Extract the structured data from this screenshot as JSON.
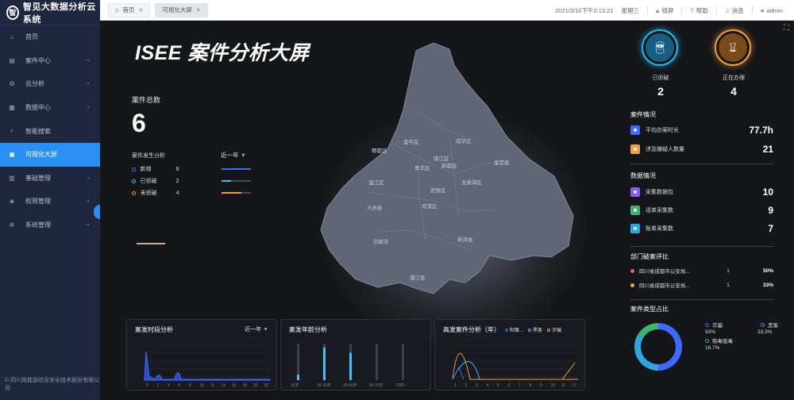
{
  "app": {
    "title": "智见大数据分析云系统",
    "logo_text": "智",
    "copyright": "© 四川效能源信息安全技术股份有限公司"
  },
  "sidebar": {
    "items": [
      {
        "label": "首页",
        "icon": "home-icon",
        "chevron": false
      },
      {
        "label": "案件中心",
        "icon": "case-icon",
        "chevron": true
      },
      {
        "label": "云分析",
        "icon": "analysis-icon",
        "chevron": true
      },
      {
        "label": "数据中心",
        "icon": "database-icon",
        "chevron": true
      },
      {
        "label": "智能搜索",
        "icon": "search-icon",
        "chevron": false
      },
      {
        "label": "可视化大屏",
        "icon": "dashboard-icon",
        "chevron": false,
        "active": true
      },
      {
        "label": "基础管理",
        "icon": "settings-icon",
        "chevron": true
      },
      {
        "label": "权限管理",
        "icon": "shield-icon",
        "chevron": true
      },
      {
        "label": "系统管理",
        "icon": "gear-icon",
        "chevron": true
      }
    ]
  },
  "tabs": [
    {
      "label": "首页"
    },
    {
      "label": "可视化大屏",
      "active": true
    }
  ],
  "header": {
    "datetime": "2021/3/10下午2:13:21",
    "weekday": "星期三",
    "lock": "锁屏",
    "help": "帮助",
    "messages": "消息",
    "user": "admin"
  },
  "dashboard": {
    "title": "ISEE 案件分析大屏",
    "total_label": "案件总数",
    "total_value": "6",
    "distribution_title": "案件发生分析",
    "range": "近一年",
    "distribution": [
      {
        "label": "新增",
        "count": "6",
        "ratio": 1.0,
        "color": "#3e6bff"
      },
      {
        "label": "已侦破",
        "count": "2",
        "ratio": 0.33,
        "color": "#3cc3ff"
      },
      {
        "label": "未侦破",
        "count": "4",
        "ratio": 0.67,
        "color": "#f0a040"
      }
    ],
    "map_labels": [
      {
        "text": "金牛区"
      },
      {
        "text": "成华区"
      },
      {
        "text": "郫都区"
      },
      {
        "text": "锦江区"
      },
      {
        "text": "新都区"
      },
      {
        "text": "青羊区"
      },
      {
        "text": "金堂县"
      },
      {
        "text": "温江区"
      },
      {
        "text": "武侯区"
      },
      {
        "text": "龙泉驿区"
      },
      {
        "text": "双流区"
      },
      {
        "text": "大邑县"
      },
      {
        "text": "邛崃市"
      },
      {
        "text": "新津县"
      },
      {
        "text": "蒲江县"
      }
    ],
    "solved": {
      "label": "已侦破",
      "value": "2"
    },
    "processing": {
      "label": "正在办理",
      "value": "4"
    },
    "case_info": {
      "title": "案件情况",
      "rows": [
        {
          "label": "平均办案时长",
          "value": "77.7h",
          "color": "#3e6bff"
        },
        {
          "label": "涉及嫌疑人数量",
          "value": "21",
          "color": "#f0a040"
        }
      ]
    },
    "data_info": {
      "title": "数据情况",
      "rows": [
        {
          "label": "采集数据包",
          "value": "10",
          "color": "#8a5cf6"
        },
        {
          "label": "话单采集数",
          "value": "9",
          "color": "#3cb371"
        },
        {
          "label": "账单采集数",
          "value": "7",
          "color": "#2aa8e0"
        }
      ]
    },
    "dept": {
      "title": "部门破案评比",
      "rows": [
        {
          "name": "四川省成都市公安局...",
          "count": "1",
          "percent": "50%",
          "color": "#f05a7e"
        },
        {
          "name": "四川省成都市公安局...",
          "count": "1",
          "percent": "33%",
          "color": "#f0a040"
        }
      ]
    },
    "case_type": {
      "title": "案件类型占比",
      "legend": [
        {
          "label": "诈骗",
          "percent": "50%",
          "color": "#3e6bff"
        },
        {
          "label": "黑客",
          "percent": "33.3%",
          "color": "#2aa8e0"
        },
        {
          "label": "制毒贩毒",
          "percent": "16.7%",
          "color": "#3cb371"
        }
      ]
    },
    "panels": [
      {
        "title": "案发时段分析",
        "range": "近一年",
        "ticks": [
          "0",
          "2",
          "4",
          "6",
          "8",
          "10",
          "12",
          "14",
          "16",
          "18",
          "20",
          "22"
        ]
      },
      {
        "title": "案发年龄分析",
        "ticks": [
          "18岁",
          "18-30岁",
          "30-50岁",
          "50-70岁",
          "70岁+"
        ],
        "values": [
          0.15,
          0.9,
          0.75,
          0,
          0
        ]
      },
      {
        "title": "高发案件分析（年）",
        "legend": [
          "制毒...",
          "黑客",
          "诈骗"
        ],
        "ticks": [
          "1",
          "2",
          "3",
          "4",
          "5",
          "6",
          "7",
          "8",
          "9",
          "10",
          "11",
          "12"
        ]
      }
    ]
  }
}
